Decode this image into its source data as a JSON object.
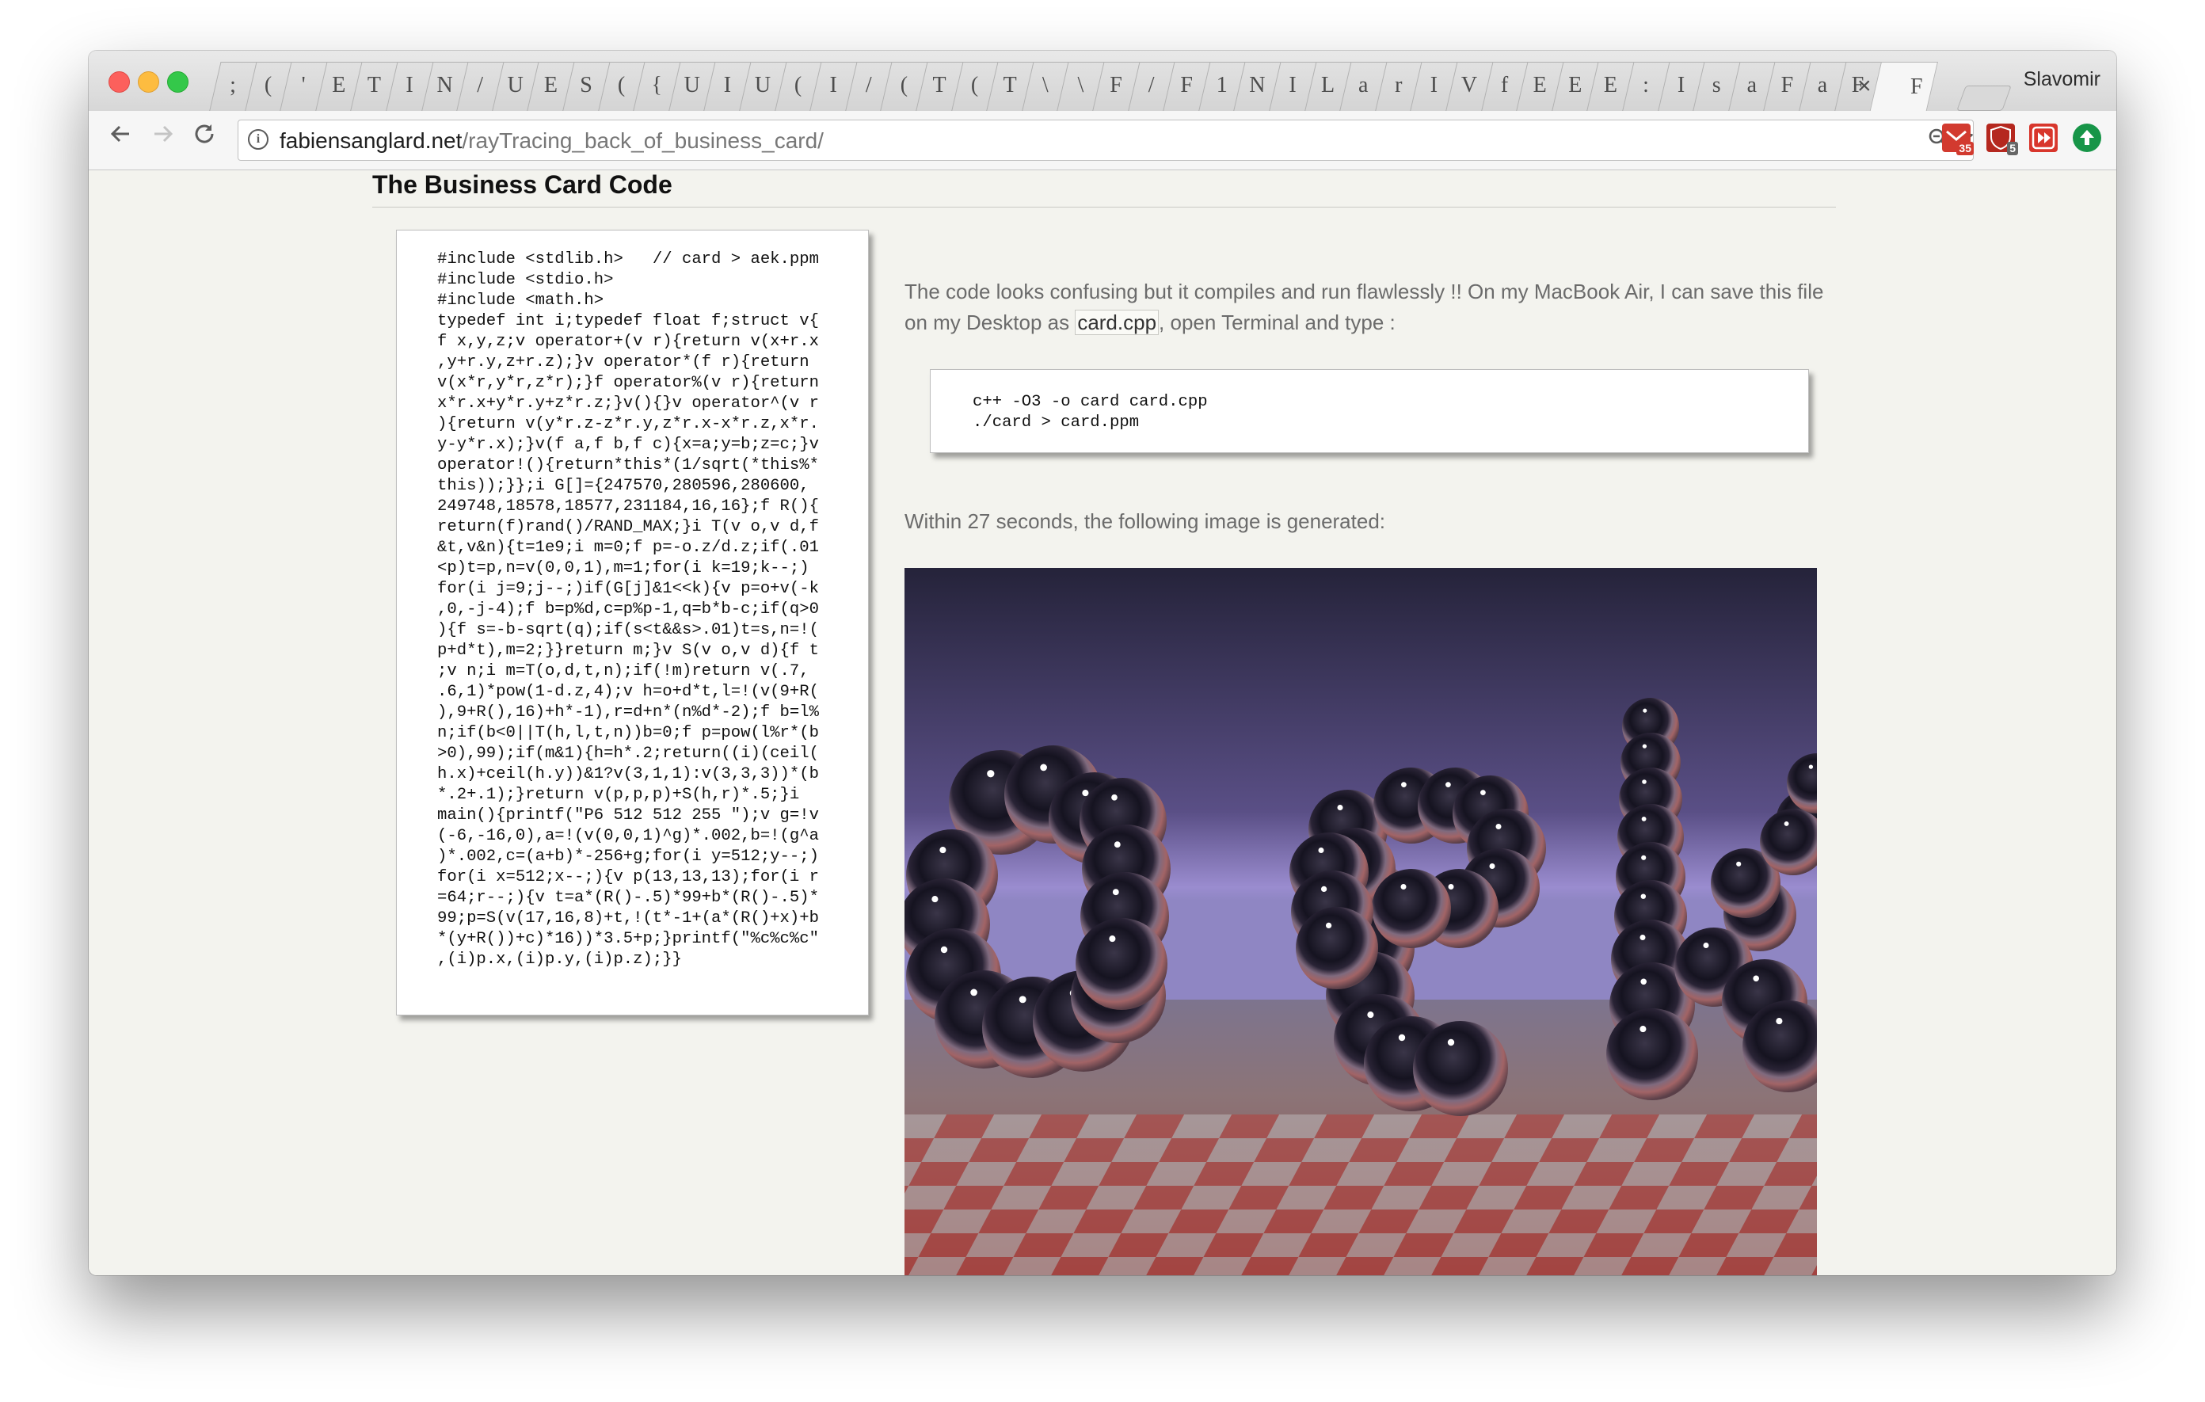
{
  "browser": {
    "profile_name": "Slavomir",
    "tab_favicons": [
      ";",
      "(",
      "'",
      "E",
      "T",
      "I",
      "N",
      "/",
      "U",
      "E",
      "S",
      "(",
      "{",
      "U",
      "I",
      "U",
      "(",
      "I",
      "/",
      "(",
      "T",
      "(",
      "T",
      "\\",
      "\\",
      "F",
      "/",
      "F",
      "1",
      "N",
      "I",
      "L",
      "a",
      "r",
      "I",
      "V",
      "f",
      "E",
      "E",
      "E",
      ":",
      "I",
      "s",
      "a",
      "F",
      "a",
      "F"
    ],
    "active_tab_close": "×",
    "last_tab_favicon": "F",
    "url_host": "fabiensanglard.net",
    "url_path": "/rayTracing_back_of_business_card/",
    "extension_badges": [
      "35",
      "5"
    ]
  },
  "page": {
    "heading": "The Business Card Code",
    "code": "#include <stdlib.h>   // card > aek.ppm\n#include <stdio.h>\n#include <math.h>\ntypedef int i;typedef float f;struct v{\nf x,y,z;v operator+(v r){return v(x+r.x\n,y+r.y,z+r.z);}v operator*(f r){return\nv(x*r,y*r,z*r);}f operator%(v r){return\nx*r.x+y*r.y+z*r.z;}v(){}v operator^(v r\n){return v(y*r.z-z*r.y,z*r.x-x*r.z,x*r.\ny-y*r.x);}v(f a,f b,f c){x=a;y=b;z=c;}v\noperator!(){return*this*(1/sqrt(*this%*\nthis));}};i G[]={247570,280596,280600,\n249748,18578,18577,231184,16,16};f R(){\nreturn(f)rand()/RAND_MAX;}i T(v o,v d,f\n&t,v&n){t=1e9;i m=0;f p=-o.z/d.z;if(.01\n<p)t=p,n=v(0,0,1),m=1;for(i k=19;k--;)\nfor(i j=9;j--;)if(G[j]&1<<k){v p=o+v(-k\n,0,-j-4);f b=p%d,c=p%p-1,q=b*b-c;if(q>0\n){f s=-b-sqrt(q);if(s<t&&s>.01)t=s,n=!(\np+d*t),m=2;}}return m;}v S(v o,v d){f t\n;v n;i m=T(o,d,t,n);if(!m)return v(.7,\n.6,1)*pow(1-d.z,4);v h=o+d*t,l=!(v(9+R(\n),9+R(),16)+h*-1),r=d+n*(n%d*-2);f b=l%\nn;if(b<0||T(h,l,t,n))b=0;f p=pow(l%r*(b\n>0),99);if(m&1){h=h*.2;return((i)(ceil(\nh.x)+ceil(h.y))&1?v(3,1,1):v(3,3,3))*(b\n*.2+.1);}return v(p,p,p)+S(h,r)*.5;}i\nmain(){printf(\"P6 512 512 255 \");v g=!v\n(-6,-16,0),a=!(v(0,0,1)^g)*.002,b=!(g^a\n)*.002,c=(a+b)*-256+g;for(i y=512;y--;)\nfor(i x=512;x--;){v p(13,13,13);for(i r\n=64;r--;){v t=a*(R()-.5)*99+b*(R()-.5)*\n99;p=S(v(17,16,8)+t,!(t*-1+(a*(R()+x)+b\n*(y+R())+c)*16))*3.5+p;}printf(\"%c%c%c\"\n,(i)p.x,(i)p.y,(i)p.z);}}",
    "para1_before": "The code looks confusing but it compiles and run flawlessly !! On my MacBook Air, I can save this file on my Desktop as ",
    "para1_code": "card.cpp",
    "para1_after": ", open Terminal and type :",
    "command": "c++ -O3 -o card card.cpp\n./card > card.ppm",
    "para2": "Within 27 seconds, the following image is generated:"
  },
  "colors": {
    "accent_red": "#d23a2f",
    "link_gray": "#6b6b6b"
  }
}
